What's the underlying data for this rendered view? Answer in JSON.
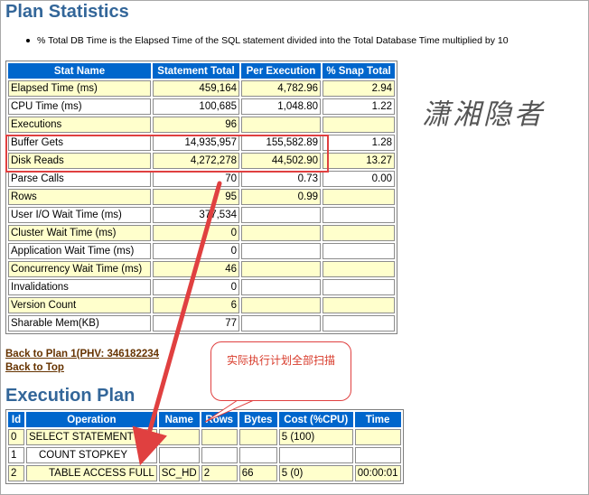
{
  "plan_statistics": {
    "title": "Plan Statistics",
    "bullet": "% Total DB Time is the Elapsed Time of the SQL statement divided into the Total Database Time multiplied by 10",
    "headers": [
      "Stat Name",
      "Statement Total",
      "Per Execution",
      "% Snap Total"
    ],
    "rows": [
      [
        "Elapsed Time (ms)",
        "459,164",
        "4,782.96",
        "2.94"
      ],
      [
        "CPU Time (ms)",
        "100,685",
        "1,048.80",
        "1.22"
      ],
      [
        "Executions",
        "96",
        "",
        ""
      ],
      [
        "Buffer Gets",
        "14,935,957",
        "155,582.89",
        "1.28"
      ],
      [
        "Disk Reads",
        "4,272,278",
        "44,502.90",
        "13.27"
      ],
      [
        "Parse Calls",
        "70",
        "0.73",
        "0.00"
      ],
      [
        "Rows",
        "95",
        "0.99",
        ""
      ],
      [
        "User I/O Wait Time (ms)",
        "377,534",
        "",
        ""
      ],
      [
        "Cluster Wait Time (ms)",
        "0",
        "",
        ""
      ],
      [
        "Application Wait Time (ms)",
        "0",
        "",
        ""
      ],
      [
        "Concurrency Wait Time (ms)",
        "46",
        "",
        ""
      ],
      [
        "Invalidations",
        "0",
        "",
        ""
      ],
      [
        "Version Count",
        "6",
        "",
        ""
      ],
      [
        "Sharable Mem(KB)",
        "77",
        "",
        ""
      ]
    ]
  },
  "links": {
    "back_to_plan": "Back to Plan 1(PHV: 346182234",
    "back_to_top": "Back to Top"
  },
  "execution_plan": {
    "title": "Execution Plan",
    "headers": [
      "Id",
      "Operation",
      "Name",
      "Rows",
      "Bytes",
      "Cost (%CPU)",
      "Time"
    ],
    "rows": [
      [
        "0",
        "SELECT STATEMENT",
        "",
        "",
        "",
        "5 (100)",
        ""
      ],
      [
        "1",
        "COUNT STOPKEY",
        "",
        "",
        "",
        "",
        ""
      ],
      [
        "2",
        "TABLE ACCESS FULL",
        "SC_HD",
        "2",
        "66",
        "5 (0)",
        "00:00:01"
      ]
    ]
  },
  "annotation": {
    "callout_text": "实际执行计划全部扫描",
    "watermark": "潇湘隐者",
    "accent_color": "#e04040"
  }
}
